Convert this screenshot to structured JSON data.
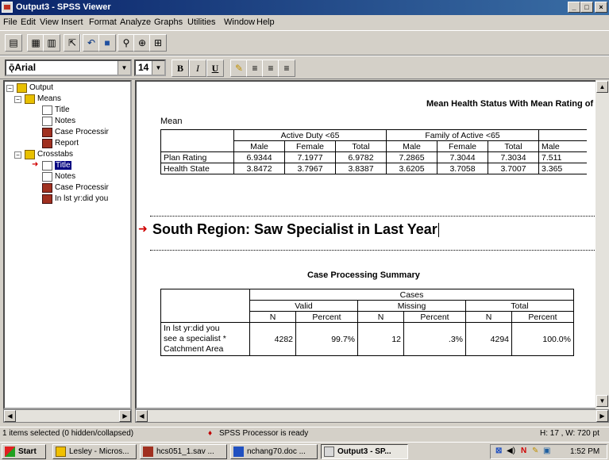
{
  "window": {
    "title": "Output3 - SPSS Viewer",
    "btn_min": "_",
    "btn_max": "□",
    "btn_close": "×"
  },
  "menu": [
    "File",
    "Edit",
    "View",
    "Insert",
    "Format",
    "Analyze",
    "Graphs",
    "Utilities",
    "Window",
    "Help"
  ],
  "toolbar": {
    "font_name": "Arial",
    "font_size": "14",
    "font_prefix": "ǭ",
    "bold": "B",
    "italic": "I",
    "underline": "U",
    "arrow": "▼"
  },
  "tree": {
    "root": "Output",
    "means": "Means",
    "means_children": [
      "Title",
      "Notes",
      "Case Processir",
      "Report"
    ],
    "crosstabs": "Crosstabs",
    "crosstabs_children": [
      "Title",
      "Notes",
      "Case Processir",
      "In lst yr:did you"
    ]
  },
  "report": {
    "title": "Mean Health Status With Mean Rating of H",
    "caption": "Mean",
    "groups": [
      "Active Duty <65",
      "Family of Active <65"
    ],
    "columns": [
      "Male",
      "Female",
      "Total",
      "Male",
      "Female",
      "Total",
      "Male"
    ],
    "rows": [
      {
        "label": "Plan Rating",
        "values": [
          "6.9344",
          "7.1977",
          "6.9782",
          "7.2865",
          "7.3044",
          "7.3034",
          "7.511"
        ]
      },
      {
        "label": "Health State",
        "values": [
          "3.8472",
          "3.7967",
          "3.8387",
          "3.6205",
          "3.7058",
          "3.7007",
          "3.365"
        ]
      }
    ]
  },
  "heading": "South Region: Saw Specialist in Last Year",
  "case_summary": {
    "title": "Case Processing Summary",
    "cases_label": "Cases",
    "groups": [
      "Valid",
      "Missing",
      "Total"
    ],
    "sub": [
      "N",
      "Percent",
      "N",
      "Percent",
      "N",
      "Percent"
    ],
    "row_label_1": "In lst yr:did you",
    "row_label_2": "see a specialist *",
    "row_label_3": "Catchment Area",
    "values": [
      "4282",
      "99.7%",
      "12",
      ".3%",
      "4294",
      "100.0%"
    ]
  },
  "status": {
    "left": "1 items selected (0 hidden/collapsed)",
    "center": "SPSS Processor  is ready",
    "right": "H: 17 , W: 720  pt"
  },
  "taskbar": {
    "start": "Start",
    "tasks": [
      "Lesley - Micros...",
      "hcs051_1.sav ...",
      "nchang70.doc ...",
      "Output3 - SP..."
    ],
    "clock": "1:52 PM"
  }
}
